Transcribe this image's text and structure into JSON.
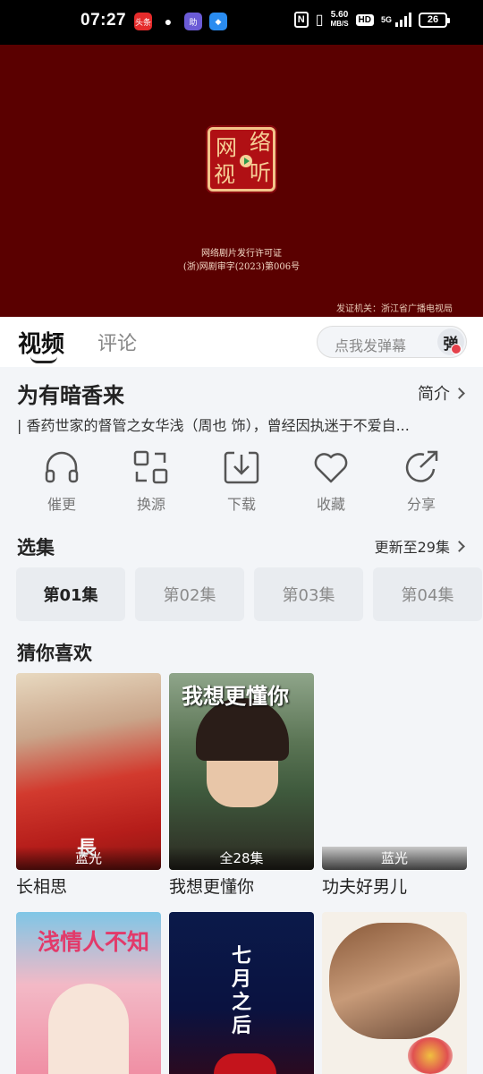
{
  "status_bar": {
    "time": "07:27",
    "apps": [
      "头条",
      "微信",
      "助",
      "盾"
    ],
    "nfc": "N",
    "speed_value": "5.60",
    "speed_unit": "MB/S",
    "hd": "HD",
    "network": "5G",
    "battery": "26"
  },
  "player": {
    "seal_chars": [
      "网",
      "络",
      "视",
      "听"
    ],
    "license_line1": "网络剧片发行许可证",
    "license_line2": "(浙)网剧审字(2023)第006号",
    "issuer": "发证机关：浙江省广播电视局"
  },
  "tabs": {
    "video": "视频",
    "comment": "评论",
    "danmaku_placeholder": "点我发弹幕",
    "danmaku_button": "弹"
  },
  "show": {
    "title": "为有暗香来",
    "intro_label": "简介",
    "synopsis": "| 香药世家的督管之女华浅（周也 饰），曾经因执迷于不爱自..."
  },
  "actions": [
    {
      "label": "催更",
      "icon": "headphones-icon"
    },
    {
      "label": "换源",
      "icon": "switch-source-icon"
    },
    {
      "label": "下载",
      "icon": "download-icon"
    },
    {
      "label": "收藏",
      "icon": "heart-icon"
    },
    {
      "label": "分享",
      "icon": "share-icon"
    }
  ],
  "episodes": {
    "heading": "选集",
    "update_status": "更新至29集",
    "items": [
      "第01集",
      "第02集",
      "第03集",
      "第04集"
    ],
    "selected": "第01集"
  },
  "recommend": {
    "heading": "猜你喜欢",
    "items": [
      {
        "title": "长相思",
        "badge": "蓝光",
        "poster_text": "長"
      },
      {
        "title": "我想更懂你",
        "badge": "全28集",
        "poster_text": "我想更懂你"
      },
      {
        "title": "功夫好男儿",
        "badge": "蓝光",
        "poster_text": ""
      },
      {
        "title": "",
        "badge": "",
        "poster_text": "浅情人不知"
      },
      {
        "title": "",
        "badge": "",
        "poster_text": "七月之后"
      },
      {
        "title": "",
        "badge": "",
        "poster_text": ""
      }
    ]
  },
  "colors": {
    "player_bg": "#5a0000",
    "seal_red": "#b01014",
    "seal_gold": "#f6cf96",
    "page_bg": "#f3f5f8"
  }
}
